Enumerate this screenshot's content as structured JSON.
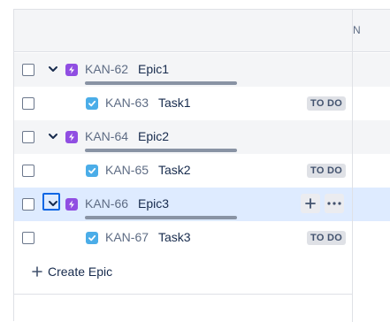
{
  "table": {
    "column_header": "N",
    "rows": [
      {
        "type": "epic",
        "key": "KAN-62",
        "summary": "Epic1"
      },
      {
        "type": "task",
        "key": "KAN-63",
        "summary": "Task1",
        "status": "TO DO"
      },
      {
        "type": "epic",
        "key": "KAN-64",
        "summary": "Epic2"
      },
      {
        "type": "task",
        "key": "KAN-65",
        "summary": "Task2",
        "status": "TO DO"
      },
      {
        "type": "epic",
        "key": "KAN-66",
        "summary": "Epic3",
        "selected": true
      },
      {
        "type": "task",
        "key": "KAN-67",
        "summary": "Task3",
        "status": "TO DO"
      }
    ],
    "row_actions": {
      "add_icon": "plus-icon",
      "more_icon": "ellipsis-icon"
    }
  },
  "create_epic": {
    "label": "Create Epic",
    "icon": "plus-icon"
  },
  "colors": {
    "epic_icon": "#904ee2",
    "task_icon": "#4bade8",
    "selected_row": "#deebff",
    "focus_ring": "#0c66e4"
  }
}
